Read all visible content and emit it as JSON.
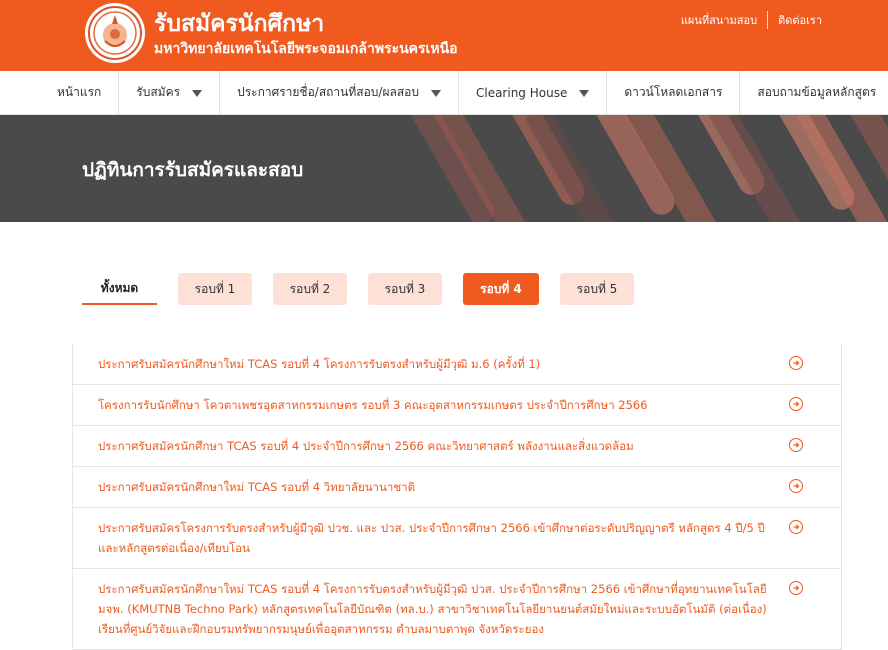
{
  "header": {
    "title": "รับสมัครนักศึกษา",
    "subtitle": "มหาวิทยาลัยเทคโนโลยีพระจอมเกล้าพระนครเหนือ",
    "links": [
      "แผนที่สนามสอบ",
      "ติดต่อเรา"
    ]
  },
  "nav": {
    "items": [
      {
        "label": "หน้าแรก",
        "dropdown": false
      },
      {
        "label": "รับสมัคร",
        "dropdown": true
      },
      {
        "label": "ประกาศรายชื่อ/สถานที่สอบ/ผลสอบ",
        "dropdown": true
      },
      {
        "label": "Clearing House",
        "dropdown": true
      },
      {
        "label": "ดาวน์โหลดเอกสาร",
        "dropdown": false
      },
      {
        "label": "สอบถามข้อมูลหลักสูตร",
        "dropdown": false
      }
    ]
  },
  "banner": {
    "title": "ปฏิทินการรับสมัครและสอบ"
  },
  "tabs": {
    "all": "ทั้งหมด",
    "rounds": [
      "รอบที่ 1",
      "รอบที่ 2",
      "รอบที่ 3",
      "รอบที่ 4",
      "รอบที่ 5"
    ],
    "active": "รอบที่ 4"
  },
  "announcements": [
    "ประกาศรับสมัครนักศึกษาใหม่ TCAS รอบที่ 4 โครงการรับตรงสำหรับผู้มีวุฒิ ม.6 (ครั้งที่ 1)",
    "โครงการรับนักศึกษา โควตาเพชรอุตสาหกรรมเกษตร รอบที่ 3 คณะอุตสาหกรรมเกษตร ประจำปีการศึกษา 2566",
    "ประกาศรับสมัครนักศึกษา TCAS รอบที่ 4 ประจำปีการศึกษา 2566 คณะวิทยาศาสตร์ พลังงานและสิ่งแวดล้อม",
    "ประกาศรับสมัครนักศึกษาใหม่ TCAS รอบที่ 4 วิทยาลัยนานาชาติ",
    "ประกาศรับสมัครโครงการรับตรงสำหรับผู้มีวุฒิ ปวช. และ ปวส. ประจำปีการศึกษา 2566 เข้าศึกษาต่อระดับปริญญาตรี หลักสูตร 4 ปี/5 ปี และหลักสูตรต่อเนื่อง/เทียบโอน",
    "ประกาศรับสมัครนักศึกษาใหม่ TCAS รอบที่ 4 โครงการรับตรงสำหรับผู้มีวุฒิ ปวส. ประจำปีการศึกษา 2566 เข้าศึกษาที่อุทยานเทคโนโลยี มจพ. (KMUTNB Techno Park) หลักสูตรเทคโนโลยีบัณฑิต (ทล.บ.) สาขาวิชาเทคโนโลยียานยนต์สมัยใหม่และระบบอัตโนมัติ (ต่อเนื่อง) เรียนที่ศูนย์วิจัยและฝึกอบรมทรัพยากรมนุษย์เพื่ออุตสาหกรรม ตำบลมาบตาพุด จังหวัดระยอง"
  ],
  "colors": {
    "brand": "#f05a1f",
    "tab_inactive_bg": "#fde0d6",
    "banner_bg": "#4a4a4a"
  }
}
